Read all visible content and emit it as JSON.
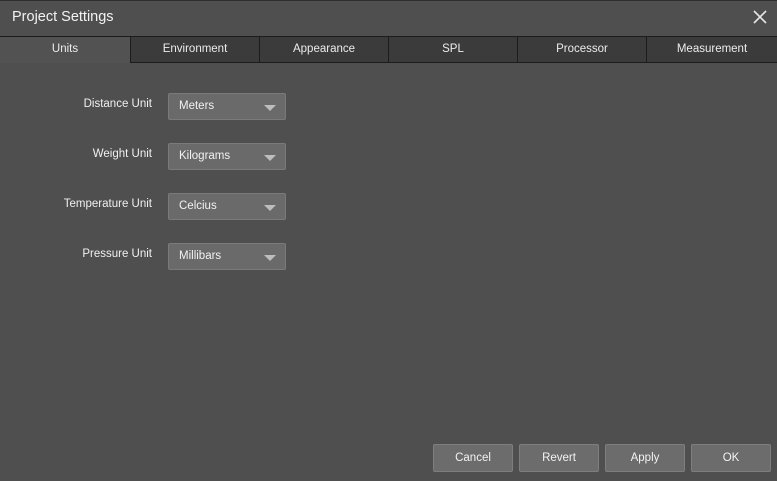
{
  "window": {
    "title": "Project Settings",
    "close_icon": "close-icon"
  },
  "tabs": [
    {
      "label": "Units",
      "active": true
    },
    {
      "label": "Environment",
      "active": false
    },
    {
      "label": "Appearance",
      "active": false
    },
    {
      "label": "SPL",
      "active": false
    },
    {
      "label": "Processor",
      "active": false
    },
    {
      "label": "Measurement",
      "active": false
    }
  ],
  "units": {
    "distance": {
      "label": "Distance Unit",
      "value": "Meters"
    },
    "weight": {
      "label": "Weight Unit",
      "value": "Kilograms"
    },
    "temperature": {
      "label": "Temperature Unit",
      "value": "Celcius"
    },
    "pressure": {
      "label": "Pressure Unit",
      "value": "Millibars"
    }
  },
  "buttons": {
    "cancel": "Cancel",
    "revert": "Revert",
    "apply": "Apply",
    "ok": "OK"
  },
  "colors": {
    "background": "#4f4f4f",
    "tab_bar": "#3b3b3b",
    "tab_active": "#525252",
    "control": "#6a6a6a",
    "text": "#f2f2f2"
  }
}
